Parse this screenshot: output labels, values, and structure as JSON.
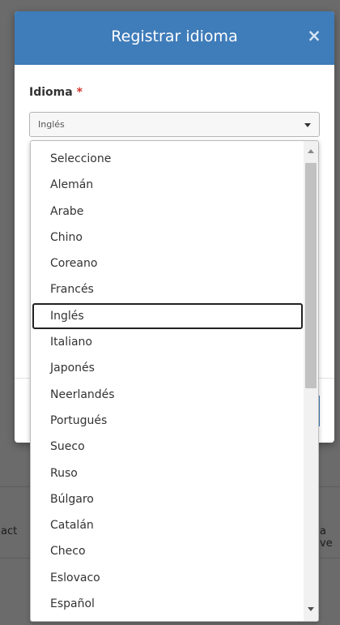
{
  "background": {
    "left_text": "act",
    "right_text": "a ve"
  },
  "modal": {
    "title": "Registrar idioma",
    "close_icon_glyph": "×",
    "field": {
      "label": "Idioma",
      "required_mark": "*",
      "selected_value": "Inglés"
    }
  },
  "dropdown": {
    "options": [
      {
        "label": "Seleccione"
      },
      {
        "label": "Alemán"
      },
      {
        "label": "Arabe"
      },
      {
        "label": "Chino"
      },
      {
        "label": "Coreano"
      },
      {
        "label": "Francés"
      },
      {
        "label": "Inglés"
      },
      {
        "label": "Italiano"
      },
      {
        "label": "Japonés"
      },
      {
        "label": "Neerlandés"
      },
      {
        "label": "Portugués"
      },
      {
        "label": "Sueco"
      },
      {
        "label": "Ruso"
      },
      {
        "label": "Búlgaro"
      },
      {
        "label": "Catalán"
      },
      {
        "label": "Checo"
      },
      {
        "label": "Eslovaco"
      },
      {
        "label": "Español"
      }
    ],
    "selected_index": 6
  },
  "colors": {
    "header": "#3f7cba",
    "overlay": "#6b6b6b",
    "required": "#d9342b"
  },
  "icons": {
    "close": "close-icon",
    "caret": "chevron-down-icon",
    "scroll_up": "scroll-up-arrow-icon",
    "scroll_down": "scroll-down-arrow-icon"
  }
}
